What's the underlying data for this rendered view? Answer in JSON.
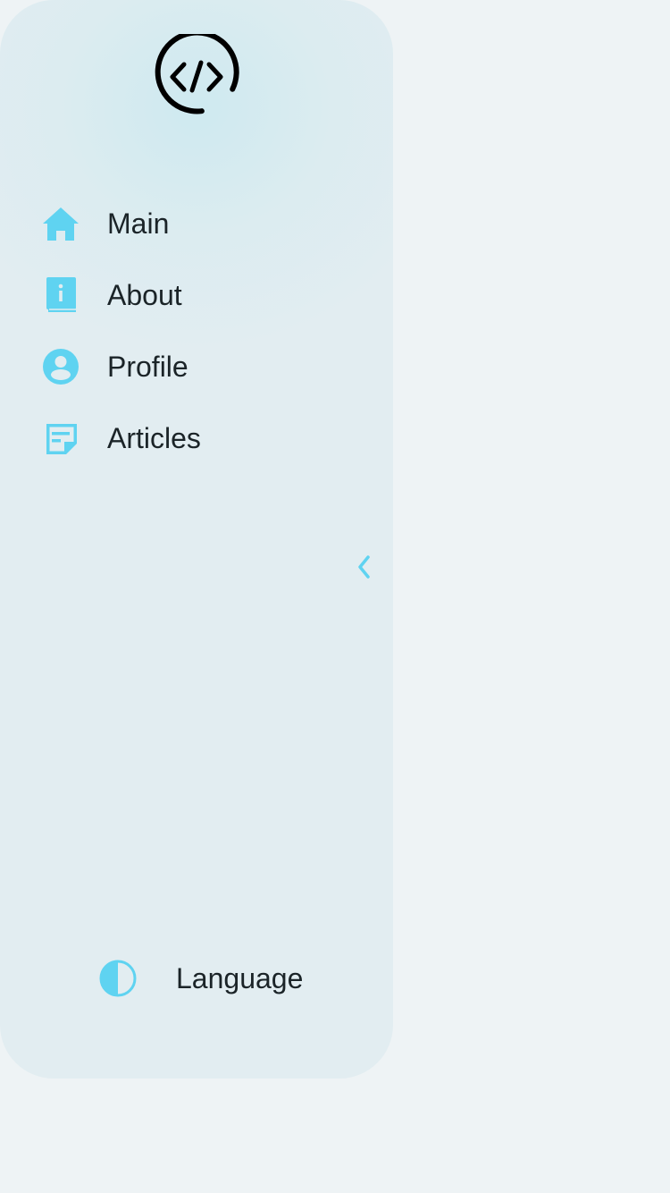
{
  "colors": {
    "accent": "#5fd3f1",
    "text": "#1b2428",
    "panel": "#e2edf1",
    "background": "#eef3f5"
  },
  "logo": {
    "icon": "code-icon"
  },
  "nav": {
    "items": [
      {
        "label": "Main",
        "icon": "home-icon"
      },
      {
        "label": "About",
        "icon": "info-book-icon"
      },
      {
        "label": "Profile",
        "icon": "user-circle-icon"
      },
      {
        "label": "Articles",
        "icon": "article-note-icon"
      }
    ]
  },
  "collapse": {
    "icon": "chevron-left-icon"
  },
  "footer": {
    "theme_icon": "half-circle-theme-icon",
    "language_label": "Language"
  }
}
